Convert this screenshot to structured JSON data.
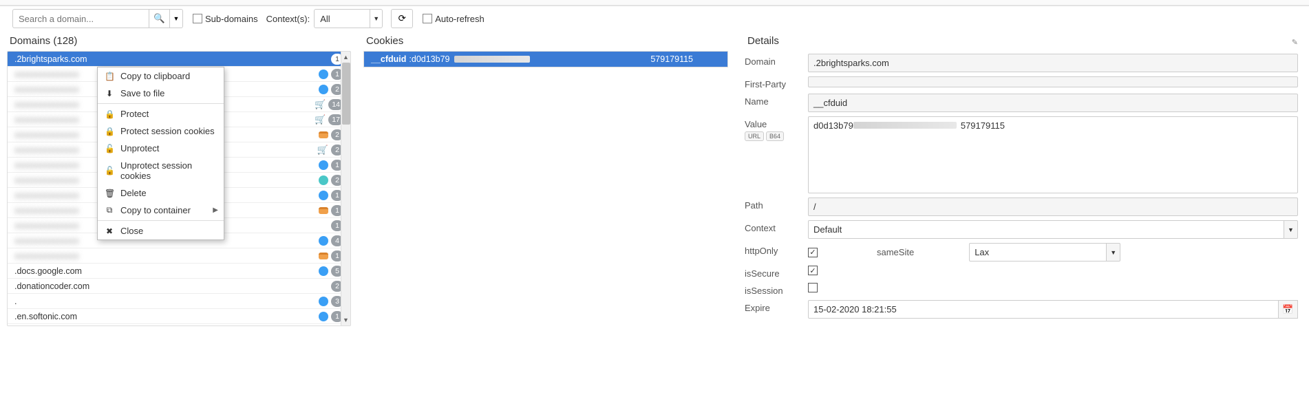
{
  "toolbar": {
    "search_placeholder": "Search a domain...",
    "subdomains_label": "Sub-domains",
    "contexts_label": "Context(s):",
    "context_value": "All",
    "autorefresh_label": "Auto-refresh"
  },
  "domains": {
    "title": "Domains (128)",
    "rows": [
      {
        "name": ".2brightsparks.com",
        "icon": "none",
        "count": "1",
        "selected": true
      },
      {
        "name": "",
        "icon": "blue",
        "count": "1"
      },
      {
        "name": "",
        "icon": "blue",
        "count": "2"
      },
      {
        "name": "",
        "icon": "cart",
        "count": "14"
      },
      {
        "name": "",
        "icon": "cart",
        "count": "17"
      },
      {
        "name": "",
        "icon": "orange",
        "count": "2"
      },
      {
        "name": "",
        "icon": "cart",
        "count": "2"
      },
      {
        "name": "",
        "icon": "blue",
        "count": "1"
      },
      {
        "name": "",
        "icon": "teal",
        "count": "2"
      },
      {
        "name": "",
        "icon": "blue",
        "count": "1"
      },
      {
        "name": "",
        "icon": "orange",
        "count": "1"
      },
      {
        "name": "",
        "icon": "none",
        "count": "1"
      },
      {
        "name": "",
        "icon": "blue",
        "count": "4"
      },
      {
        "name": "",
        "icon": "orange",
        "count": "1"
      },
      {
        "name": ".docs.google.com",
        "icon": "blue",
        "count": "5"
      },
      {
        "name": ".donationcoder.com",
        "icon": "none",
        "count": "2"
      },
      {
        "name": ".",
        "icon": "blue",
        "count": "3"
      },
      {
        "name": ".en.softonic.com",
        "icon": "blue",
        "count": "1"
      }
    ]
  },
  "context_menu": {
    "items": [
      {
        "icon": "📋",
        "label": "Copy to clipboard"
      },
      {
        "icon": "⬇",
        "label": "Save to file"
      },
      {
        "sep": true
      },
      {
        "icon": "🔒",
        "label": "Protect"
      },
      {
        "icon": "🔒",
        "label": "Protect session cookies"
      },
      {
        "icon": "🔓",
        "label": "Unprotect"
      },
      {
        "icon": "🔓",
        "label": "Unprotect session cookies"
      },
      {
        "icon": "🗑",
        "label": "Delete"
      },
      {
        "icon": "⧉",
        "label": "Copy to container",
        "submenu": true
      },
      {
        "sep": true
      },
      {
        "icon": "✖",
        "label": "Close"
      }
    ]
  },
  "cookies": {
    "title": "Cookies",
    "rows": [
      {
        "name": "__cfduid",
        "value": ":d0d13b79",
        "trailing": "579179115",
        "selected": true
      }
    ]
  },
  "details": {
    "title": "Details",
    "labels": {
      "domain": "Domain",
      "firstparty": "First-Party",
      "name": "Name",
      "value": "Value",
      "url": "URL",
      "b64": "B64",
      "path": "Path",
      "context": "Context",
      "httponly": "httpOnly",
      "samesite": "sameSite",
      "issecure": "isSecure",
      "issession": "isSession",
      "expire": "Expire"
    },
    "values": {
      "domain": ".2brightsparks.com",
      "firstparty": "",
      "name": "__cfduid",
      "value_start": "d0d13b79",
      "value_end": "579179115",
      "path": "/",
      "context": "Default",
      "samesite": "Lax",
      "httponly_checked": true,
      "issecure_checked": true,
      "issession_checked": false,
      "expire": "15-02-2020 18:21:55"
    }
  }
}
